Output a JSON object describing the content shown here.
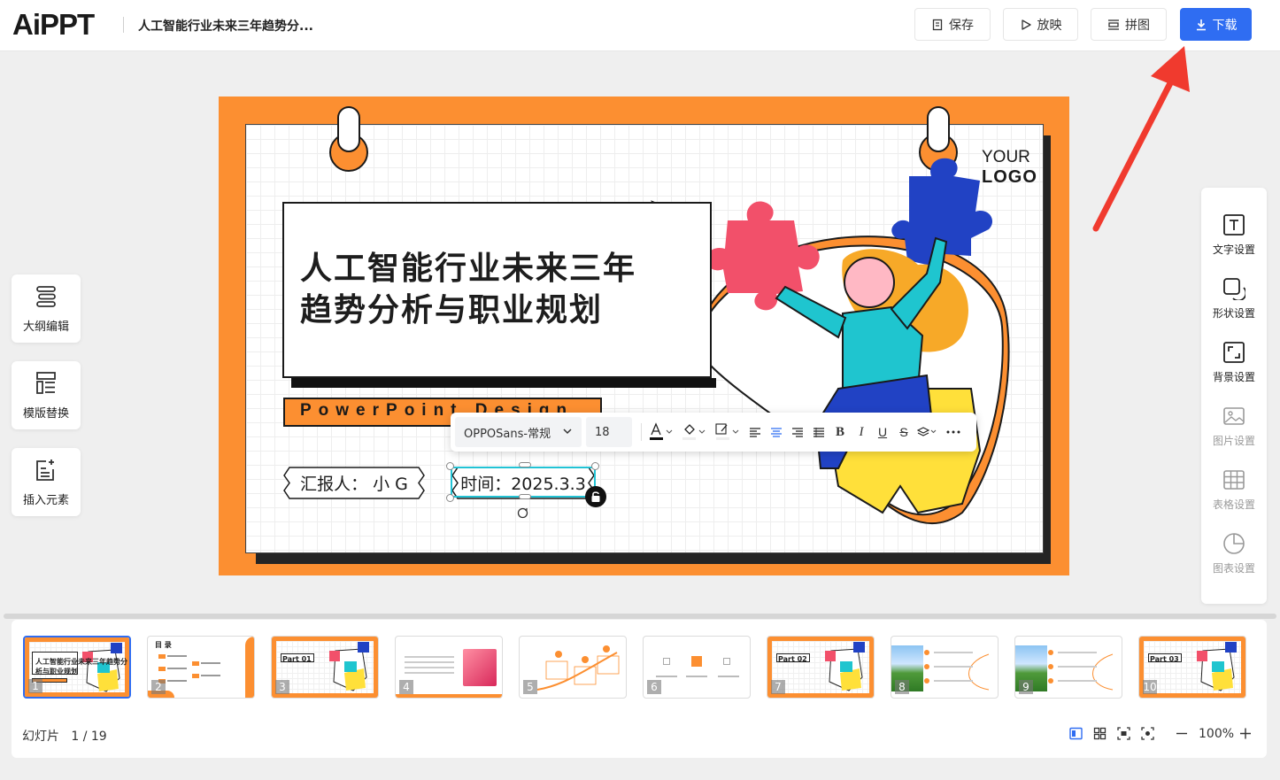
{
  "app": {
    "logo": "AiPPT",
    "doc_title": "人工智能行业未来三年趋势分..."
  },
  "toolbar": {
    "save_label": "保存",
    "play_label": "放映",
    "puzzle_label": "拼图",
    "download_label": "下载"
  },
  "left_tools": [
    {
      "label": "大纲编辑",
      "icon": "outline-icon"
    },
    {
      "label": "模版替换",
      "icon": "template-icon"
    },
    {
      "label": "插入元素",
      "icon": "insert-icon"
    }
  ],
  "right_panel": [
    {
      "label": "文字设置",
      "icon": "text-icon",
      "enabled": true
    },
    {
      "label": "形状设置",
      "icon": "shape-icon",
      "enabled": true
    },
    {
      "label": "背景设置",
      "icon": "background-icon",
      "enabled": true
    },
    {
      "label": "图片设置",
      "icon": "image-icon",
      "enabled": false
    },
    {
      "label": "表格设置",
      "icon": "table-icon",
      "enabled": false
    },
    {
      "label": "图表设置",
      "icon": "chart-icon",
      "enabled": false
    }
  ],
  "slide": {
    "title_line1": "人工智能行业未来三年",
    "title_line2": "趋势分析与职业规划",
    "subtitle": "PowerPoint Design",
    "logo_line1": "YOUR",
    "logo_line2": "LOGO",
    "reporter": "汇报人：  小 G",
    "date": "时间：2025.3.3"
  },
  "format_toolbar": {
    "font": "OPPOSans-常规",
    "size": "18"
  },
  "filmstrip": {
    "slides": [
      {
        "num": "1",
        "caption": "人工智能行业未来三年趋势分析与职业规划",
        "style": "cover",
        "active": true
      },
      {
        "num": "2",
        "caption": "目 录",
        "style": "toc"
      },
      {
        "num": "3",
        "caption": "Part 01",
        "style": "part"
      },
      {
        "num": "4",
        "caption": "",
        "style": "pink"
      },
      {
        "num": "5",
        "caption": "",
        "style": "timeline"
      },
      {
        "num": "6",
        "caption": "",
        "style": "icons"
      },
      {
        "num": "7",
        "caption": "Part 02",
        "style": "part"
      },
      {
        "num": "8",
        "caption": "",
        "style": "photo"
      },
      {
        "num": "9",
        "caption": "",
        "style": "photo"
      },
      {
        "num": "10",
        "caption": "Part 03",
        "style": "part"
      }
    ]
  },
  "status": {
    "slide_label": "幻灯片",
    "slide_pos": "1 / 19",
    "zoom": "100%"
  },
  "colors": {
    "accent": "#2f6df2",
    "slide_orange": "#fc8f31",
    "arrow_red": "#f03a2e"
  }
}
